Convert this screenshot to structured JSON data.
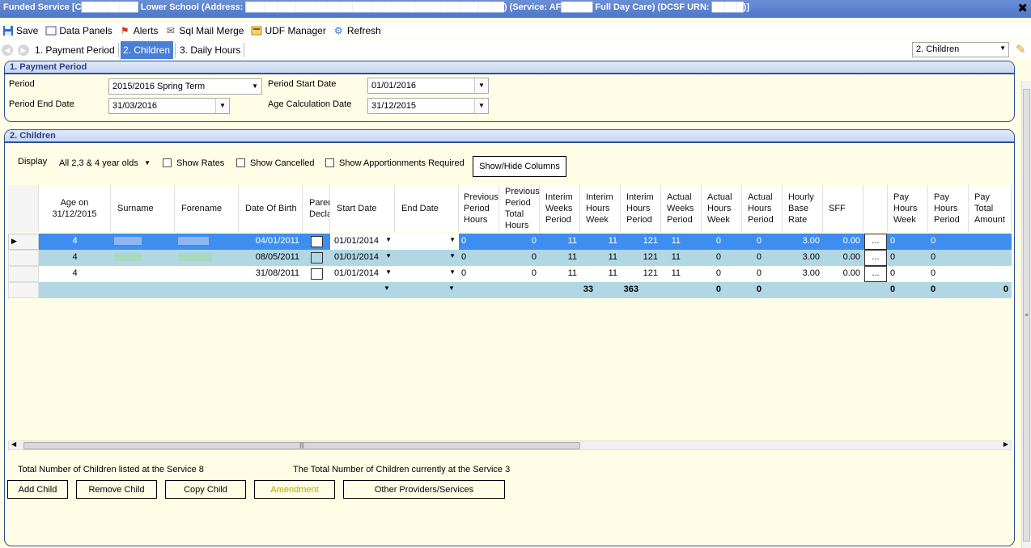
{
  "window": {
    "title": "Funded Service [C█████████ Lower School (Address: █████████████████████████████████████████) (Service: AF█████ Full Day Care) (DCSF URN: █████)]",
    "close": "✖"
  },
  "toolbar": {
    "save": "Save",
    "data_panels": "Data Panels",
    "alerts": "Alerts",
    "sql_mail_merge": "Sql Mail Merge",
    "udf_manager": "UDF Manager",
    "refresh": "Refresh"
  },
  "nav": {
    "tabs": [
      "1. Payment Period",
      "2. Children",
      "3. Daily Hours"
    ],
    "active": "2. Children",
    "section_select": "2. Children"
  },
  "payment_period": {
    "heading": "1. Payment Period",
    "period_label": "Period",
    "period_value": "2015/2016 Spring Term",
    "start_label": "Period Start Date",
    "start_value": "01/01/2016",
    "end_label": "Period End Date",
    "end_value": "31/03/2016",
    "age_calc_label": "Age Calculation Date",
    "age_calc_value": "31/12/2015"
  },
  "children": {
    "heading": "2. Children",
    "display_label": "Display",
    "display_value": "All 2,3 & 4 year olds",
    "show_rates": "Show Rates",
    "show_cancelled": "Show Cancelled",
    "show_apportionments": "Show Apportionments Required",
    "show_hide_columns": "Show/Hide Columns",
    "columns": {
      "age": "Age on 31/12/2015",
      "surname": "Surname",
      "forename": "Forename",
      "dob": "Date Of Birth",
      "parent": "Parent Declaration",
      "start": "Start Date",
      "end": "End Date",
      "prev_hours": "Previous Period Hours",
      "prev_total": "Previous Period Total Hours",
      "interim_weeks_period": "Interim Weeks Period",
      "interim_hours_week": "Interim Hours Week",
      "interim_hours_period": "Interim Hours Period",
      "actual_weeks_period": "Actual Weeks Period",
      "actual_hours_week": "Actual Hours Week",
      "actual_hours_period": "Actual Hours Period",
      "hourly_base_rate": "Hourly Base Rate",
      "sff": "SFF",
      "pay_hours_week": "Pay Hours Week",
      "pay_hours_period": "Pay Hours Period",
      "pay_total_amount": "Pay Total Amount"
    },
    "rows": [
      {
        "age": "4",
        "dob": "04/01/2011",
        "start": "01/01/2014",
        "prev_hours": "0",
        "prev_total": "0",
        "iwp": "11",
        "ihw": "11",
        "ihp": "121",
        "awp": "11",
        "ahw": "0",
        "ahp": "0",
        "rate": "3.00",
        "sff": "0.00",
        "ellipsis": "...",
        "phw": "0",
        "php": "0"
      },
      {
        "age": "4",
        "dob": "08/05/2011",
        "start": "01/01/2014",
        "prev_hours": "0",
        "prev_total": "0",
        "iwp": "11",
        "ihw": "11",
        "ihp": "121",
        "awp": "11",
        "ahw": "0",
        "ahp": "0",
        "rate": "3.00",
        "sff": "0.00",
        "ellipsis": "...",
        "phw": "0",
        "php": "0"
      },
      {
        "age": "4",
        "dob": "31/08/2011",
        "start": "01/01/2014",
        "prev_hours": "0",
        "prev_total": "0",
        "iwp": "11",
        "ihw": "11",
        "ihp": "121",
        "awp": "11",
        "ahw": "0",
        "ahp": "0",
        "rate": "3.00",
        "sff": "0.00",
        "ellipsis": "...",
        "phw": "0",
        "php": "0"
      }
    ],
    "totals": {
      "ihw": "33",
      "ihp": "363",
      "ahw": "0",
      "ahp": "0",
      "phw": "0",
      "php": "0",
      "pta": "0"
    },
    "total_listed": "Total Number of Children listed at the Service 8",
    "total_current": "The Total Number of Children currently at the Service 3",
    "buttons": {
      "add": "Add Child",
      "remove": "Remove Child",
      "copy": "Copy Child",
      "amendment": "Amendment",
      "other": "Other Providers/Services"
    }
  },
  "colors": {
    "selected_row": "#3d8ef0",
    "alt_row": "#b1d7e4",
    "background": "#fffde6",
    "title_blue": "#4f77c9"
  }
}
